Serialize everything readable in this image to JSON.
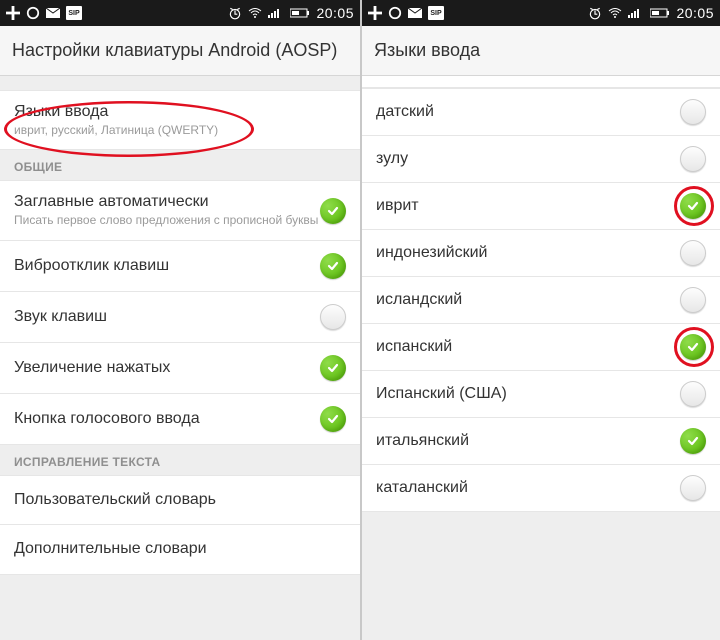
{
  "statusbar": {
    "time": "20:05",
    "icons_left": [
      "plus",
      "ring",
      "mail",
      "phone-small"
    ],
    "icons_right": [
      "alarm",
      "wifi",
      "signal",
      "battery"
    ]
  },
  "left": {
    "header": "Настройки клавиатуры Android (AOSP)",
    "input_languages": {
      "title": "Языки ввода",
      "sub": "иврит, русский, Латиница (QWERTY)"
    },
    "section_general": "ОБЩИЕ",
    "items": [
      {
        "title": "Заглавные автоматически",
        "sub": "Писать первое слово предложения с прописной буквы",
        "on": true
      },
      {
        "title": "Виброотклик клавиш",
        "on": true
      },
      {
        "title": "Звук клавиш",
        "on": false
      },
      {
        "title": "Увеличение нажатых",
        "on": true
      },
      {
        "title": "Кнопка голосового ввода",
        "on": true
      }
    ],
    "section_correction": "ИСПРАВЛЕНИЕ ТЕКСТА",
    "correction_items": [
      {
        "title": "Пользовательский словарь"
      },
      {
        "title": "Дополнительные словари"
      }
    ]
  },
  "right": {
    "header": "Языки ввода",
    "items": [
      {
        "title": "датский",
        "on": false,
        "highlight": false
      },
      {
        "title": "зулу",
        "on": false,
        "highlight": false
      },
      {
        "title": "иврит",
        "on": true,
        "highlight": true
      },
      {
        "title": "индонезийский",
        "on": false,
        "highlight": false
      },
      {
        "title": "исландский",
        "on": false,
        "highlight": false
      },
      {
        "title": "испанский",
        "on": true,
        "highlight": true
      },
      {
        "title": "Испанский (США)",
        "on": false,
        "highlight": false
      },
      {
        "title": "итальянский",
        "on": true,
        "highlight": false
      },
      {
        "title": "каталанский",
        "on": false,
        "highlight": false
      }
    ]
  }
}
